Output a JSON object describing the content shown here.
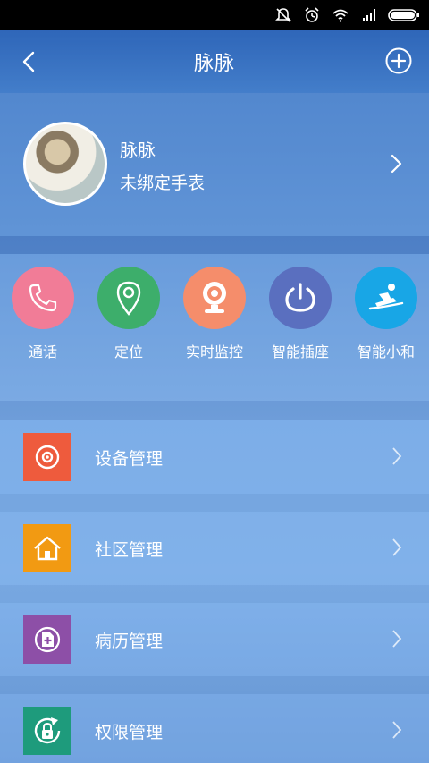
{
  "status_bar": {
    "icons": [
      "mute-icon",
      "alarm-icon",
      "wifi-icon",
      "signal-icon",
      "battery-icon"
    ]
  },
  "header": {
    "title": "脉脉",
    "back_icon": "chevron-left-icon",
    "add_icon": "plus-circle-icon"
  },
  "profile": {
    "name": "脉脉",
    "status": "未绑定手表"
  },
  "shortcuts": [
    {
      "label": "通话",
      "icon": "phone-icon",
      "color": "#f17c97"
    },
    {
      "label": "定位",
      "icon": "location-pin-icon",
      "color": "#3dae6b"
    },
    {
      "label": "实时监控",
      "icon": "camera-icon",
      "color": "#f58d6b"
    },
    {
      "label": "智能插座",
      "icon": "power-icon",
      "color": "#5a6fbf"
    },
    {
      "label": "智能小和",
      "icon": "sled-icon",
      "color": "#18a6e6"
    }
  ],
  "menu": [
    {
      "label": "设备管理",
      "icon": "gear-icon",
      "color": "#ee5b3d"
    },
    {
      "label": "社区管理",
      "icon": "house-icon",
      "color": "#f29a12"
    },
    {
      "label": "病历管理",
      "icon": "medical-record-icon",
      "color": "#8d4fa7"
    },
    {
      "label": "权限管理",
      "icon": "lock-refresh-icon",
      "color": "#1e9b7c"
    }
  ]
}
